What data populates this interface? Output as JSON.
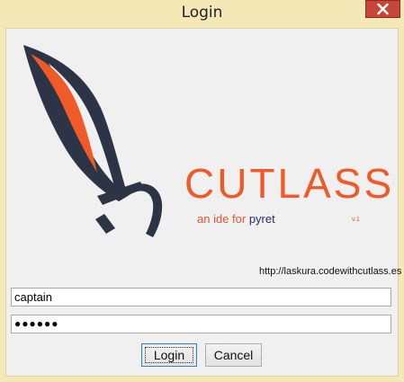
{
  "window": {
    "title": "Login"
  },
  "brand": {
    "name": "CUTLASS",
    "tagline_prefix": "an ide for",
    "tagline_lang": "pyret",
    "version": "v.1",
    "url": "http://laskura.codewithcutlass.es",
    "colors": {
      "accent": "#f05a28",
      "dark": "#2c3445"
    }
  },
  "form": {
    "username_value": "captain",
    "password_mask": "●●●●●●"
  },
  "buttons": {
    "login_label": "Login",
    "cancel_label": "Cancel"
  }
}
